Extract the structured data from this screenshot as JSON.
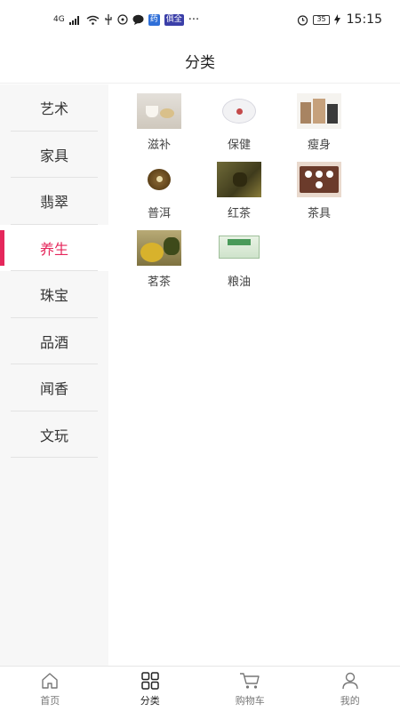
{
  "status_bar": {
    "signal_label": "4G",
    "app_badge_1": "药",
    "app_badge_2": "俱全",
    "more": "···",
    "battery": "35",
    "time": "15:15"
  },
  "header": {
    "title": "分类"
  },
  "sidebar": {
    "active_index": 3,
    "active_color": "#e5275b",
    "items": [
      {
        "label": "艺术"
      },
      {
        "label": "家具"
      },
      {
        "label": "翡翠"
      },
      {
        "label": "养生"
      },
      {
        "label": "珠宝"
      },
      {
        "label": "品酒"
      },
      {
        "label": "闻香"
      },
      {
        "label": "文玩"
      }
    ]
  },
  "categories": [
    {
      "label": "滋补",
      "thumb": "zibu"
    },
    {
      "label": "保健",
      "thumb": "baojian"
    },
    {
      "label": "瘦身",
      "thumb": "shoushen"
    },
    {
      "label": "普洱",
      "thumb": "puer"
    },
    {
      "label": "红茶",
      "thumb": "hongcha"
    },
    {
      "label": "茶具",
      "thumb": "chaju"
    },
    {
      "label": "茗茶",
      "thumb": "mingcha"
    },
    {
      "label": "粮油",
      "thumb": "liangyou"
    }
  ],
  "tabbar": {
    "active_index": 1,
    "tabs": [
      {
        "label": "首页",
        "icon": "home-icon"
      },
      {
        "label": "分类",
        "icon": "grid-icon"
      },
      {
        "label": "购物车",
        "icon": "cart-icon"
      },
      {
        "label": "我的",
        "icon": "user-icon"
      }
    ]
  }
}
